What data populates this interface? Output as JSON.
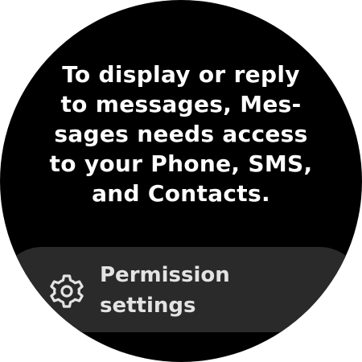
{
  "message": {
    "lines": [
      "To display or reply",
      "to messages, Mes-",
      "sages needs access",
      "to your Phone, SMS,",
      "and Contacts."
    ]
  },
  "permission_chip": {
    "icon": "gear-icon",
    "label_lines": [
      "Permission",
      "settings"
    ]
  },
  "colors": {
    "background": "#000000",
    "text": "#ffffff",
    "chip_background": "#2a2a2b",
    "chip_text": "#e3e3e3"
  }
}
